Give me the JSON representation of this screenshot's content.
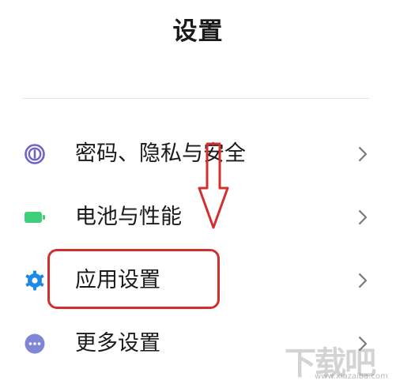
{
  "header": {
    "title": "设置"
  },
  "menu": {
    "items": [
      {
        "label": "密码、隐私与安全",
        "icon": "fingerprint-icon",
        "color": "#6f63c9"
      },
      {
        "label": "电池与性能",
        "icon": "battery-icon",
        "color": "#3fcf7a"
      },
      {
        "label": "应用设置",
        "icon": "gear-icon",
        "color": "#1e88e5"
      },
      {
        "label": "更多设置",
        "icon": "more-icon",
        "color": "#7f86d6"
      }
    ]
  },
  "annotation": {
    "color": "#d32f2f",
    "highlighted_item": "应用设置"
  },
  "watermark": {
    "text": "下载吧",
    "url": "www.xiazaiba.com"
  }
}
